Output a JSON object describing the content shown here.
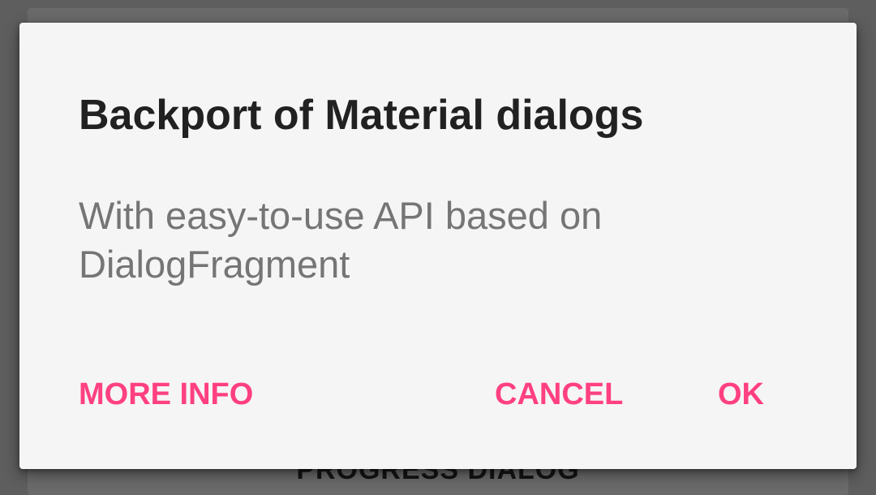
{
  "background": {
    "button_label": "PROGRESS DIALOG"
  },
  "dialog": {
    "title": "Backport of Material dialogs",
    "message": "With easy-to-use API based on DialogFragment",
    "buttons": {
      "neutral": "MORE INFO",
      "negative": "CANCEL",
      "positive": "OK"
    }
  },
  "colors": {
    "accent": "#ff4081",
    "dialog_background": "#f5f5f5",
    "title_text": "#212121",
    "message_text": "#757575",
    "scrim": "#5e5e5e"
  }
}
